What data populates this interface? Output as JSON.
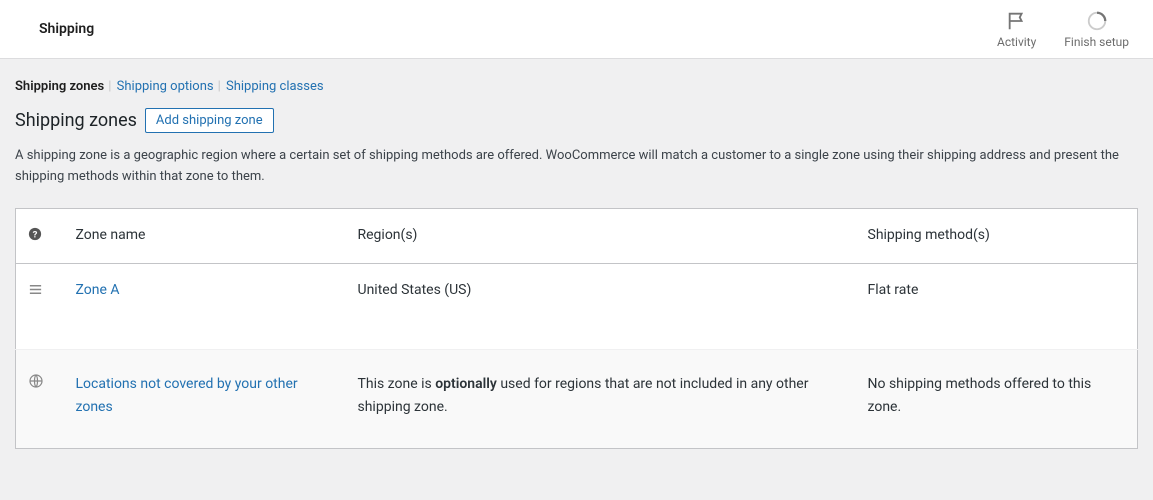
{
  "header": {
    "title": "Shipping",
    "activity_label": "Activity",
    "finish_label": "Finish setup"
  },
  "subtabs": {
    "zones": "Shipping zones",
    "options": "Shipping options",
    "classes": "Shipping classes"
  },
  "page": {
    "title": "Shipping zones",
    "add_button": "Add shipping zone",
    "description": "A shipping zone is a geographic region where a certain set of shipping methods are offered. WooCommerce will match a customer to a single zone using their shipping address and present the shipping methods within that zone to them."
  },
  "table": {
    "headers": {
      "name": "Zone name",
      "regions": "Region(s)",
      "methods": "Shipping method(s)"
    },
    "rows": [
      {
        "name": "Zone A",
        "region": "United States (US)",
        "method": "Flat rate"
      }
    ],
    "fallback": {
      "name": "Locations not covered by your other zones",
      "region_pre": "This zone is ",
      "region_strong": "optionally",
      "region_post": " used for regions that are not included in any other shipping zone.",
      "method": "No shipping methods offered to this zone."
    }
  }
}
